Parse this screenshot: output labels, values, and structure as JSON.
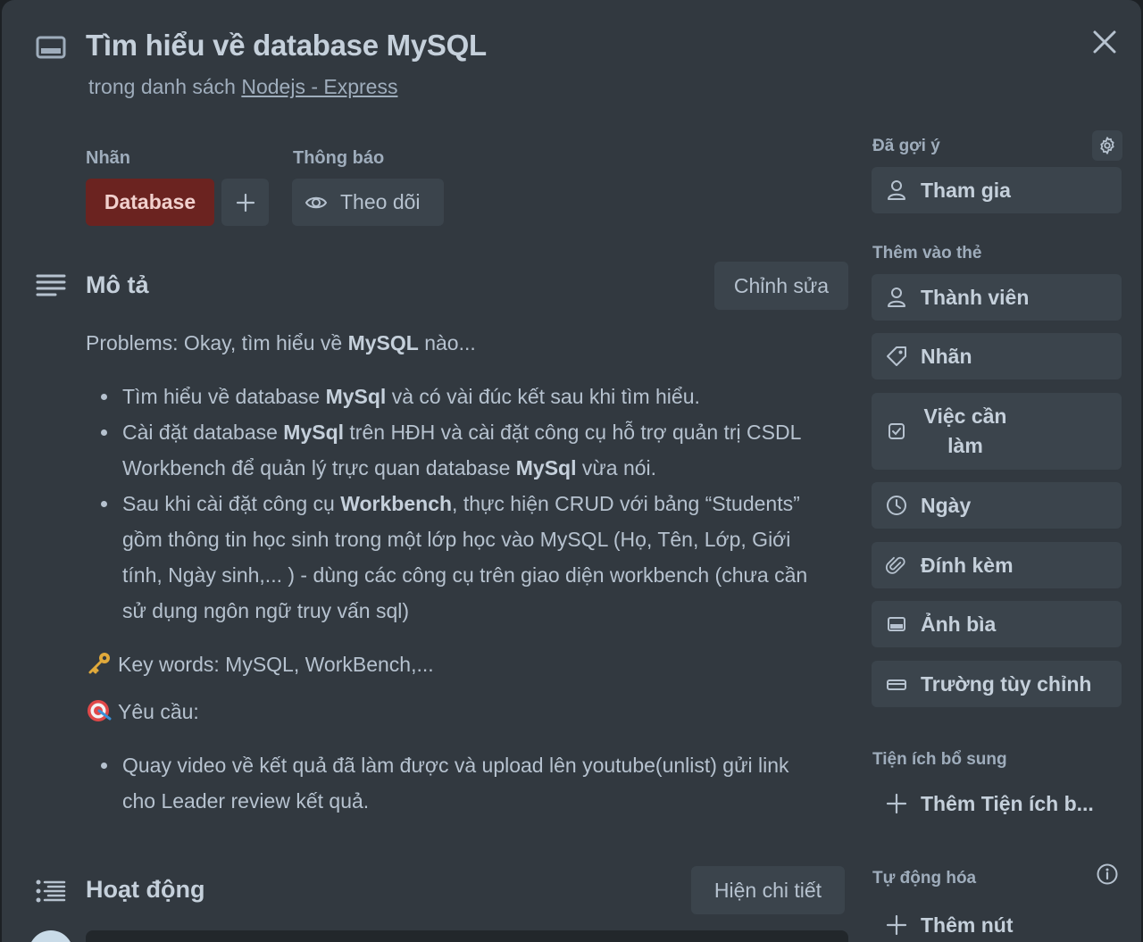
{
  "header": {
    "title": "Tìm hiểu về database MySQL",
    "subtitle_prefix": "trong danh sách ",
    "list_name": "Nodejs - Express"
  },
  "labels": {
    "section_label": "Nhãn",
    "chip_text": "Database",
    "chip_color": "#6b2320"
  },
  "notifications": {
    "section_label": "Thông báo",
    "watch_label": "Theo dõi"
  },
  "description": {
    "heading": "Mô tả",
    "edit_label": "Chỉnh sửa",
    "intro_prefix": "Problems: Okay, tìm hiểu về ",
    "intro_bold": "MySQL",
    "intro_suffix": " nào...",
    "bullets": [
      {
        "a": "Tìm hiểu về database ",
        "b": "MySql",
        "c": " và có vài đúc kết sau khi tìm hiểu."
      },
      {
        "a": "Cài đặt database ",
        "b": "MySql",
        "c": " trên HĐH và cài đặt công cụ hỗ trợ quản trị CSDL",
        "d": "Workbench để quản lý trực quan database ",
        "e": "MySql",
        "f": " vừa nói."
      },
      {
        "a": "Sau khi cài đặt công cụ ",
        "b": "Workbench",
        "c": ", thực hiện CRUD với bảng “Students”",
        "d": "gồm thông tin học sinh trong một lớp học vào MySQL (Họ, Tên, Lớp, Giới",
        "e": "tính, Ngày sinh,... ) - dùng các công cụ trên giao diện workbench (chưa cần",
        "f": "sử dụng ngôn ngữ truy vấn sql)"
      }
    ],
    "keywords": "Key words: MySQL, WorkBench,...",
    "requirements": "Yêu cầu:",
    "req_bullet_line1": "Quay video về kết quả đã làm được và upload lên youtube(unlist) gửi link",
    "req_bullet_line2": "cho Leader review kết quả."
  },
  "activity": {
    "heading": "Hoạt động",
    "details_label": "Hiện chi tiết"
  },
  "sidebar": {
    "suggested_label": "Đã gợi ý",
    "join_label": "Tham gia",
    "add_to_card_label": "Thêm vào thẻ",
    "members_label": "Thành viên",
    "labels_label": "Nhãn",
    "checklist_line1": "Việc cần",
    "checklist_line2": "làm",
    "dates_label": "Ngày",
    "attachment_label": "Đính kèm",
    "cover_label": "Ảnh bìa",
    "custom_fields_label": "Trường tùy chỉnh",
    "powerups_label": "Tiện ích bổ sung",
    "add_powerups_label": "Thêm Tiện ích b...",
    "automation_label": "Tự động hóa",
    "add_button_label": "Thêm nút"
  }
}
